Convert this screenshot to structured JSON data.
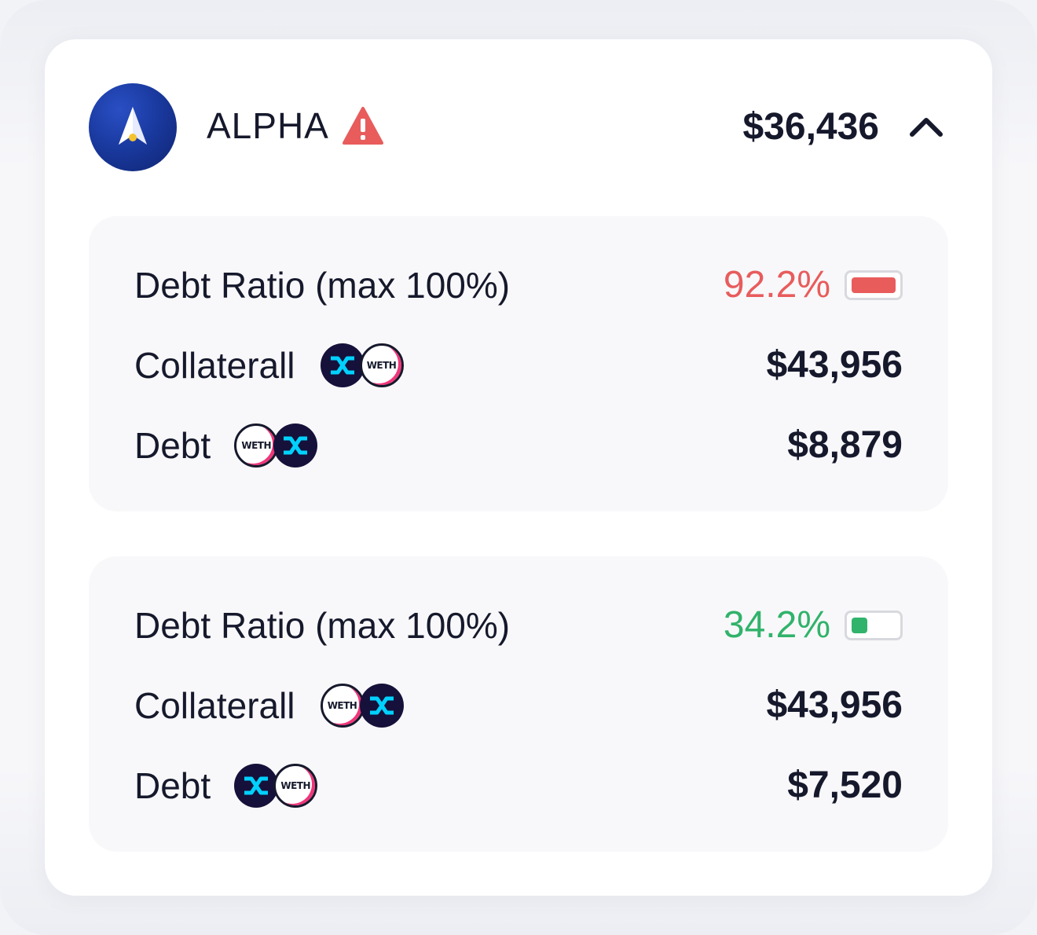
{
  "header": {
    "protocol_name": "ALPHA",
    "total_value": "$36,436",
    "warning": true,
    "expanded": true
  },
  "positions": [
    {
      "debt_ratio_label": "Debt Ratio (max 100%)",
      "debt_ratio_value": "92.2%",
      "debt_ratio_fraction": 0.922,
      "debt_ratio_status": "danger",
      "collateral_label": "Collaterall",
      "collateral_tokens": [
        "SNX",
        "WETH"
      ],
      "collateral_value": "$43,956",
      "debt_label": "Debt",
      "debt_tokens": [
        "WETH",
        "SNX"
      ],
      "debt_value": "$8,879"
    },
    {
      "debt_ratio_label": "Debt Ratio (max 100%)",
      "debt_ratio_value": "34.2%",
      "debt_ratio_fraction": 0.342,
      "debt_ratio_status": "safe",
      "collateral_label": "Collaterall",
      "collateral_tokens": [
        "WETH",
        "SNX"
      ],
      "collateral_value": "$43,956",
      "debt_label": "Debt",
      "debt_tokens": [
        "SNX",
        "WETH"
      ],
      "debt_value": "$7,520"
    }
  ],
  "colors": {
    "danger": "#e85c5c",
    "safe": "#31b36b",
    "text": "#16192c",
    "logo_blue": "#1a3aa0",
    "snx_bg": "#15113a",
    "snx_cyan": "#00d1ff",
    "weth_pink": "#f0367a"
  },
  "icons": {
    "protocol_logo": "alpha-homora-logo-icon",
    "warning": "warning-triangle-icon",
    "collapse": "chevron-up-icon",
    "token_snx": "snx-token-icon",
    "token_weth": "weth-token-icon"
  }
}
